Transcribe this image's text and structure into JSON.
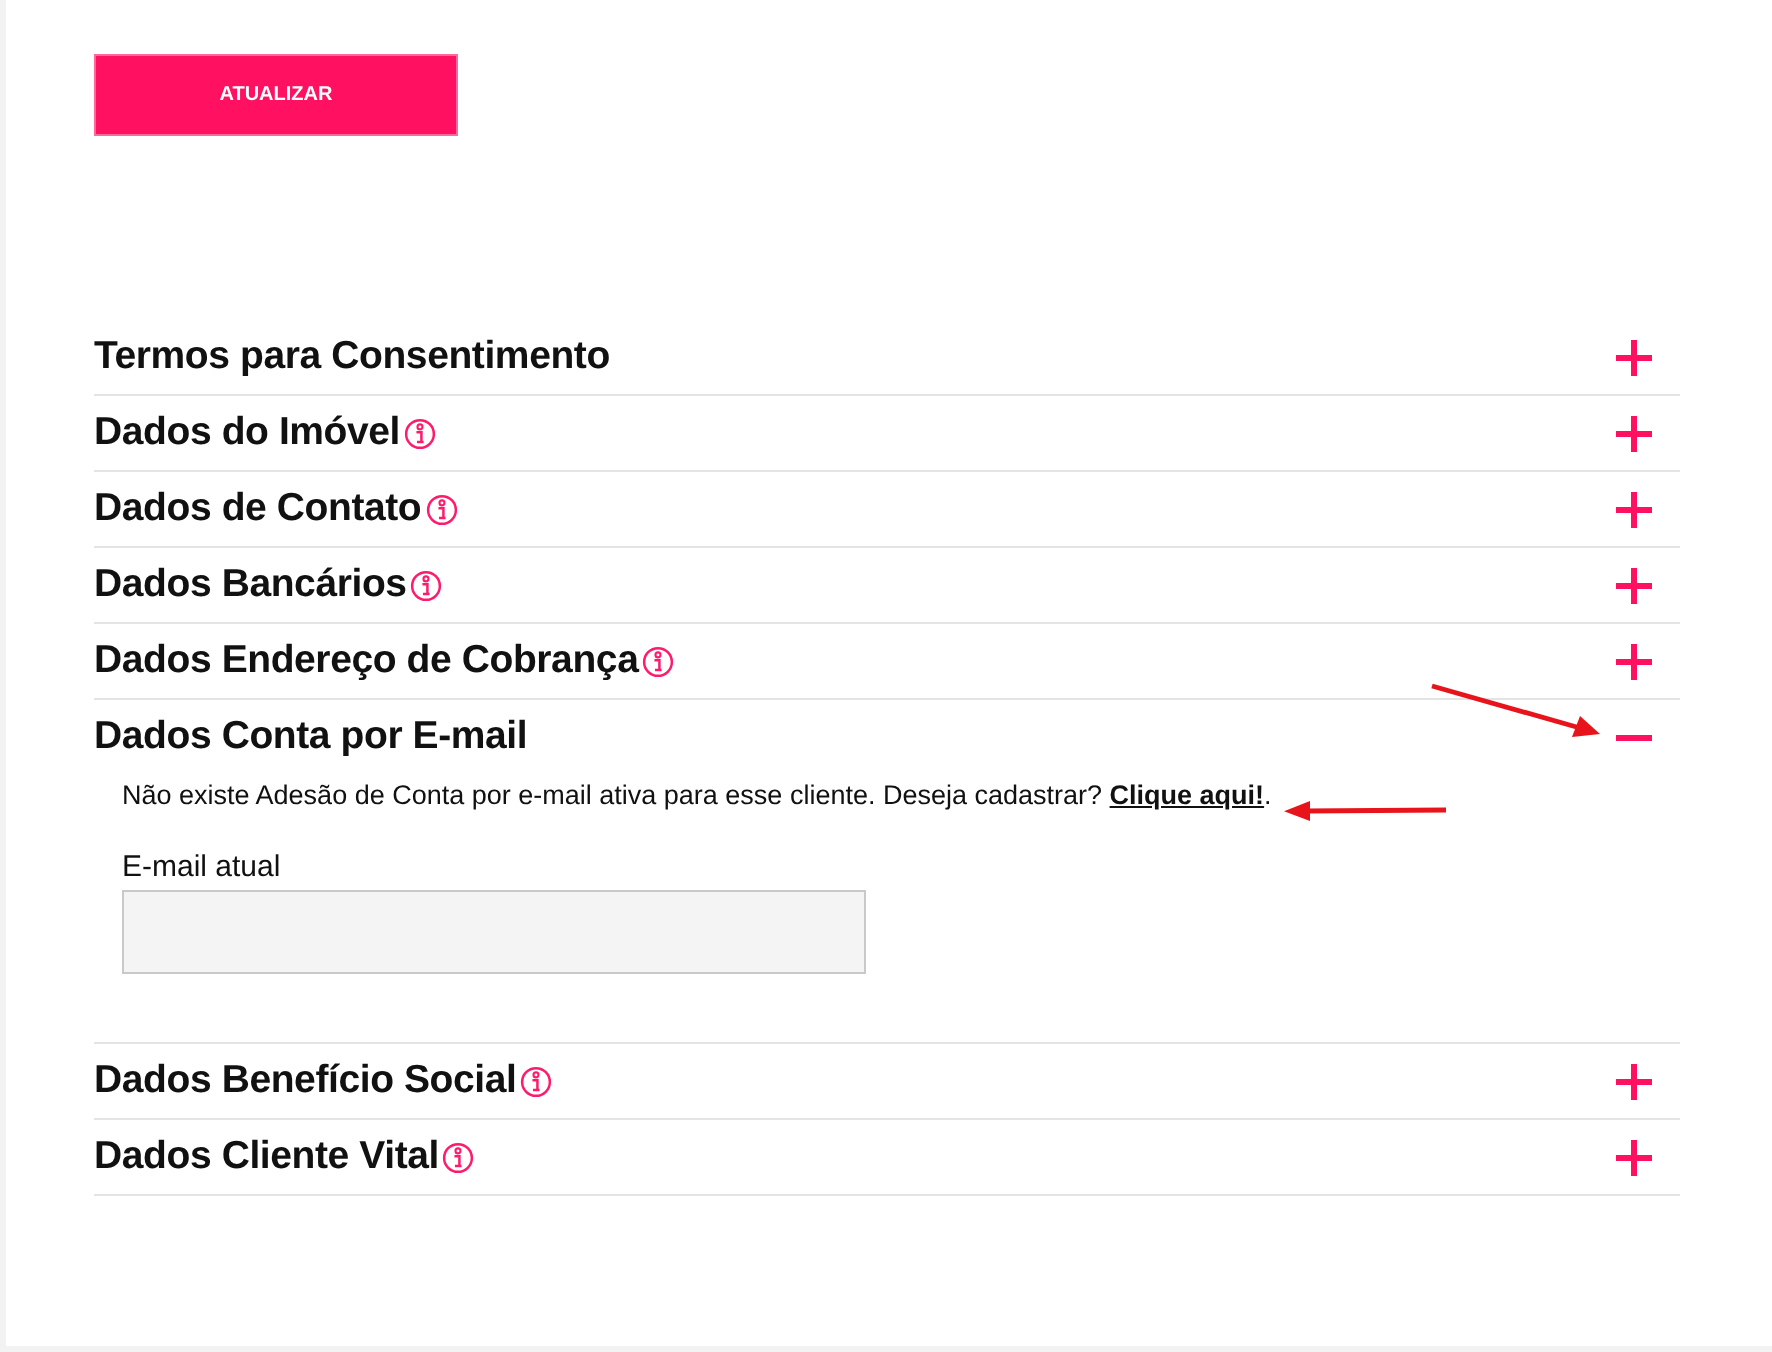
{
  "button": {
    "label": "ATUALIZAR"
  },
  "sections": [
    {
      "title": "Termos para Consentimento",
      "has_info": false,
      "expanded": false
    },
    {
      "title": "Dados do Imóvel",
      "has_info": true,
      "expanded": false
    },
    {
      "title": "Dados de Contato",
      "has_info": true,
      "expanded": false
    },
    {
      "title": "Dados Bancários",
      "has_info": true,
      "expanded": false
    },
    {
      "title": "Dados Endereço de Cobrança",
      "has_info": true,
      "expanded": false
    },
    {
      "title": "Dados Conta por E-mail",
      "has_info": false,
      "expanded": true,
      "body": {
        "message": "Não existe Adesão de Conta por e-mail ativa para esse cliente. Deseja cadastrar?",
        "link": "Clique aqui!",
        "after_link": ".",
        "field": {
          "label": "E-mail atual"
        }
      }
    },
    {
      "title": "Dados Benefício Social",
      "has_info": true,
      "expanded": false
    },
    {
      "title": "Dados Cliente Vital",
      "has_info": true,
      "expanded": false
    }
  ]
}
